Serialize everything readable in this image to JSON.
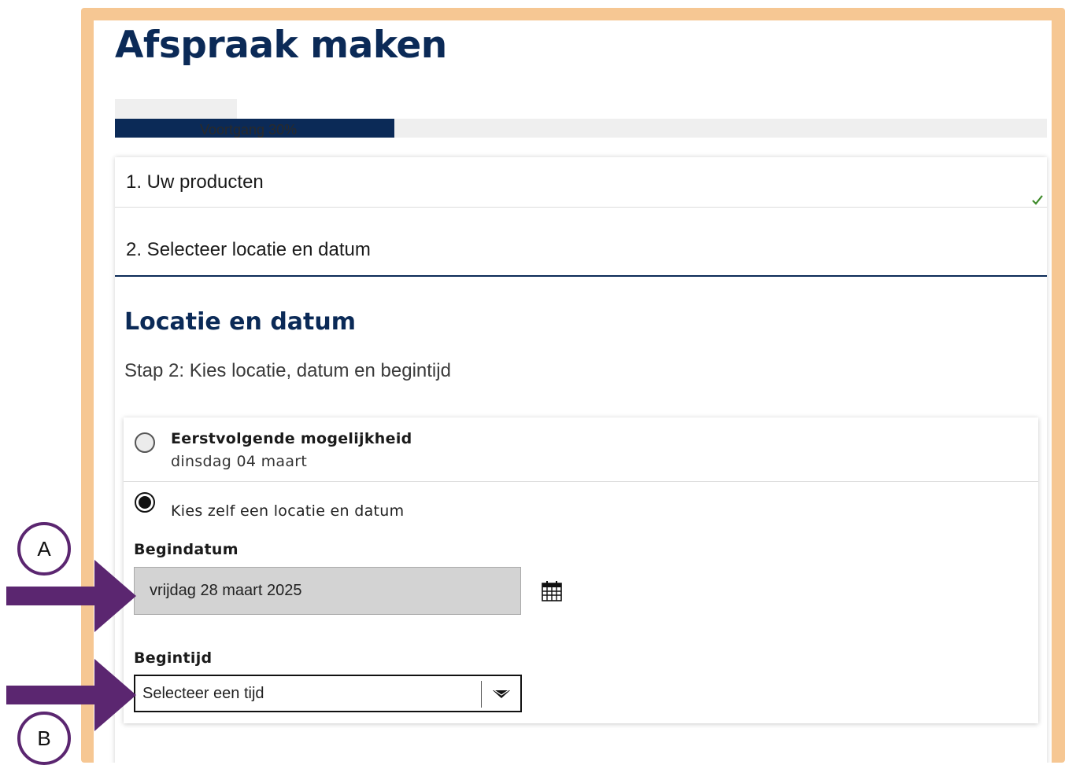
{
  "page": {
    "title": "Afspraak maken",
    "progress": {
      "label": "Voortgang 30%",
      "percent": 30
    }
  },
  "steps": [
    {
      "label": "1. Uw producten",
      "completed": true
    },
    {
      "label": "2. Selecteer locatie en datum",
      "active": true
    }
  ],
  "section": {
    "title": "Locatie en datum",
    "subtitle": "Stap 2: Kies locatie, datum en begintijd"
  },
  "options": {
    "first": {
      "title": "Eerstvolgende mogelijkheid",
      "subtitle": "dinsdag 04 maart",
      "selected": false
    },
    "own": {
      "label": "Kies zelf een locatie en datum",
      "selected": true
    }
  },
  "form": {
    "start_date_label": "Begindatum",
    "start_date_value": "vrijdag 28 maart 2025",
    "start_time_label": "Begintijd",
    "start_time_value": "Selecteer een tijd"
  },
  "annotations": {
    "a": "A",
    "b": "B",
    "arrow_color": "#5b2670",
    "frame_color": "#f6c793"
  },
  "colors": {
    "primary": "#0b2a57",
    "check": "#3e8a2a"
  },
  "icons": [
    "check-icon",
    "calendar-icon",
    "chevron-down-icon",
    "arrow-right-icon"
  ]
}
